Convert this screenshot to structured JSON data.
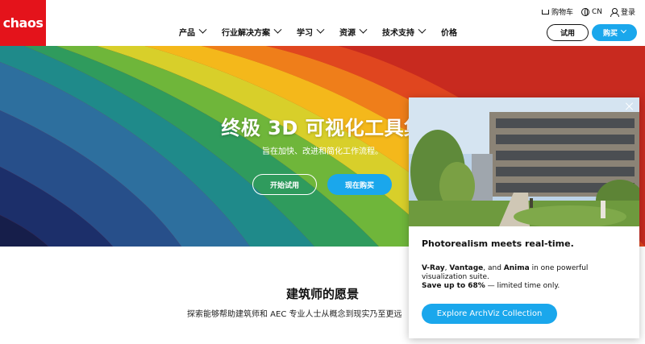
{
  "header": {
    "logo": "chaos",
    "nav": [
      {
        "label": "产品",
        "dropdown": true
      },
      {
        "label": "行业解决方案",
        "dropdown": true
      },
      {
        "label": "学习",
        "dropdown": true
      },
      {
        "label": "资源",
        "dropdown": true
      },
      {
        "label": "技术支持",
        "dropdown": true
      },
      {
        "label": "价格",
        "dropdown": false
      }
    ],
    "util": {
      "cart": "购物车",
      "lang": "CN",
      "login": "登录"
    },
    "trial_button": "试用",
    "buy_button": "购买"
  },
  "hero": {
    "title": "终极 3D 可视化工具集",
    "subtitle": "旨在加快、改进和简化工作流程。",
    "trial_button": "开始试用",
    "buy_button": "现在购买"
  },
  "section": {
    "title": "建筑师的愿景",
    "text": "探索能够帮助建筑师和 AEC 专业人士从概念到现实乃至更远"
  },
  "popup": {
    "heading": "Photorealism meets real-time.",
    "body_bold_1": "V-Ray",
    "body_sep_1": ", ",
    "body_bold_2": "Vantage",
    "body_sep_2": ", and ",
    "body_bold_3": "Anima",
    "body_rest": " in one powerful visualization suite.",
    "save_bold": "Save up to 68%",
    "save_rest": " — limited time only.",
    "cta": "Explore ArchViz Collection"
  },
  "colors": {
    "brand_red": "#e4131b",
    "accent_blue": "#1aa7ec"
  }
}
